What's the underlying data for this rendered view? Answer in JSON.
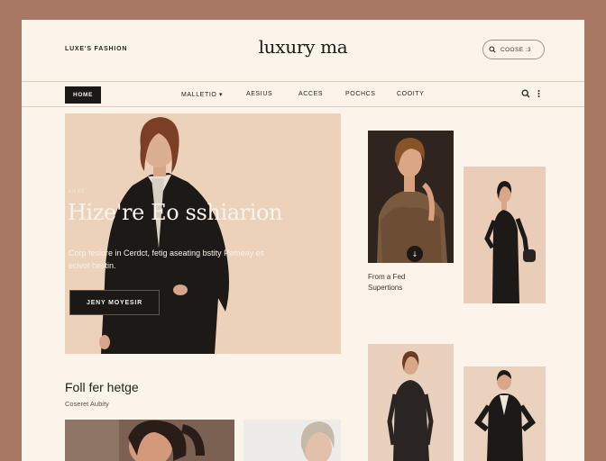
{
  "header": {
    "tagline": "LUXE'S FASHION",
    "logo": "luxury ma",
    "search_label": "COOSE :3"
  },
  "nav": {
    "home": "HOME",
    "items": [
      "MALLETIO ▾",
      "AESIUS",
      "ACCES",
      "POCHCS",
      "COOITY"
    ]
  },
  "hero": {
    "kicker": "LUXE",
    "title": "Hize're Eo sshiarion",
    "body": "Corp fesiore in Cerdct, fetig aseating bstity Pemeay es ecivot hestin.",
    "cta": "JENY MOYESIR"
  },
  "product_caption": "From a Fed Supertions",
  "section": {
    "title": "Foll fer hetge",
    "subtitle": "Coseret Aubity"
  },
  "colors": {
    "frame": "#a87865",
    "page": "#fbf4ea",
    "dark": "#1b1816",
    "hero_bg": "#ecd2bb"
  }
}
